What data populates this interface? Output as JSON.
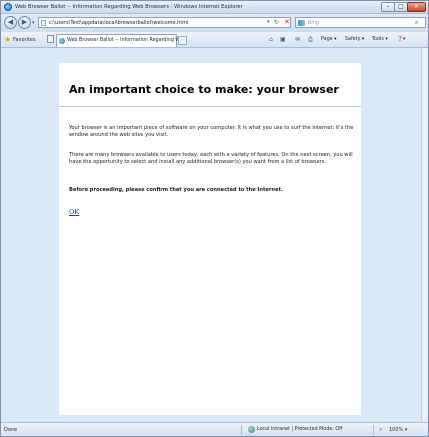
{
  "window": {
    "title": "Web Browser Ballot -- Information Regarding Web Browsers - Windows Internet Explorer",
    "buttons": {
      "minimize": "–",
      "maximize": "□",
      "close": "✕"
    }
  },
  "address_bar": {
    "url": "c:\\users\\Test\\appdata\\local\\browserballot\\welcome.html",
    "search_placeholder": "Bing",
    "icons": [
      "back-icon",
      "forward-icon",
      "refresh-icon",
      "stop-icon",
      "search-icon"
    ]
  },
  "command_bar": {
    "favorites_label": "Favorites",
    "tab_label": "Web Browser Ballot -- Information Regarding We...",
    "page_label": "Page ▾",
    "safety_label": "Safety ▾",
    "tools_label": "Tools ▾",
    "help_label": "❓▾"
  },
  "page": {
    "heading": "An important choice to make: your browser",
    "paragraph1": "Your browser is an important piece of software on your computer. It is what you use to surf the Internet: it's the window around the web sites you visit.",
    "paragraph2": "There are many browsers available to users today, each with a variety of features. On the next screen, you will have the opportunity to select and install any additional browser(s) you want from a list of browsers.",
    "paragraph3": "Before proceeding, please confirm that you are connected to the Internet.",
    "ok_link": "OK"
  },
  "status_bar": {
    "status": "Done",
    "zone": "Local intranet | Protected Mode: Off",
    "zoom": "100% ▾"
  },
  "colors": {
    "viewport_background": "#d9e9f7",
    "link": "#1a3c9b",
    "chrome": "#dbe7f4"
  }
}
